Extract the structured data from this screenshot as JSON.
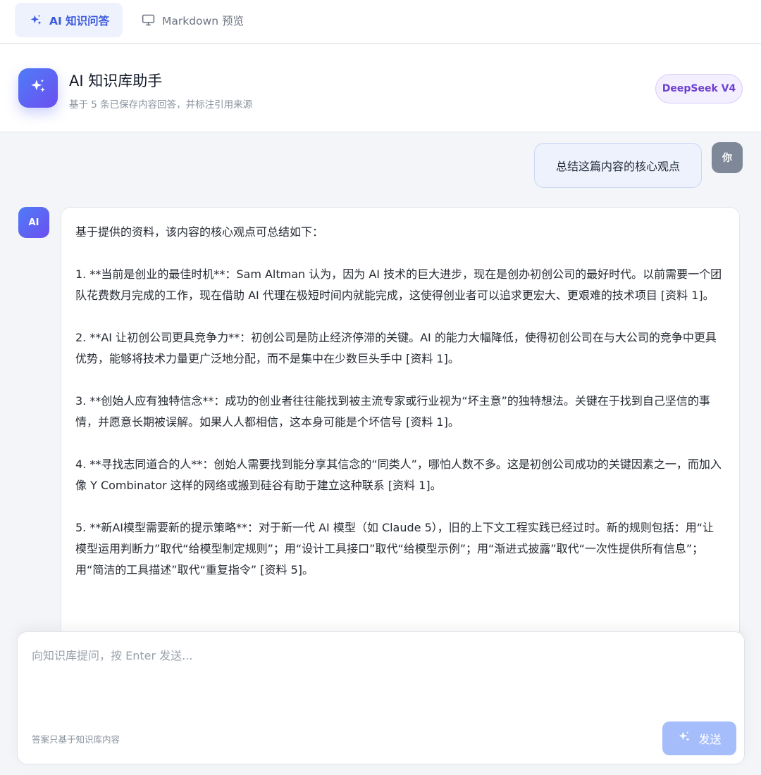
{
  "tabs": [
    {
      "label": "AI 知识问答",
      "icon": "sparkle-icon",
      "active": true
    },
    {
      "label": "Markdown 预览",
      "icon": "monitor-icon",
      "active": false
    }
  ],
  "header": {
    "title": "AI 知识库助手",
    "subtitle": "基于 5 条已保存内容回答，并标注引用来源",
    "logo_icon": "sparkle-icon",
    "model_badge": "DeepSeek V4"
  },
  "chat": {
    "user": {
      "avatar_label": "你",
      "message": "总结这篇内容的核心观点"
    },
    "assistant": {
      "avatar_label": "AI",
      "message": "基于提供的资料，该内容的核心观点可总结如下：\n\n1. **当前是创业的最佳时机**：Sam Altman 认为，因为 AI 技术的巨大进步，现在是创办初创公司的最好时代。以前需要一个团队花费数月完成的工作，现在借助 AI 代理在极短时间内就能完成，这使得创业者可以追求更宏大、更艰难的技术项目 [资料 1]。\n\n2. **AI 让初创公司更具竞争力**：初创公司是防止经济停滞的关键。AI 的能力大幅降低，使得初创公司在与大公司的竞争中更具优势，能够将技术力量更广泛地分配，而不是集中在少数巨头手中 [资料 1]。\n\n3. **创始人应有独特信念**：成功的创业者往往能找到被主流专家或行业视为“坏主意”的独特想法。关键在于找到自己坚信的事情，并愿意长期被误解。如果人人都相信，这本身可能是个坏信号 [资料 1]。\n\n4. **寻找志同道合的人**：创始人需要找到能分享其信念的“同类人”，哪怕人数不多。这是初创公司成功的关键因素之一，而加入像 Y Combinator 这样的网络或搬到硅谷有助于建立这种联系 [资料 1]。\n\n5. **新AI模型需要新的提示策略**：对于新一代 AI 模型（如 Claude 5），旧的上下文工程实践已经过时。新的规则包括：用“让模型运用判断力”取代“给模型制定规则”；用“设计工具接口”取代“给模型示例”；用“渐进式披露”取代“一次性提供所有信息”；用“简洁的工具描述”取代“重复指令” [资料 5]。"
    }
  },
  "composer": {
    "placeholder": "向知识库提问，按 Enter 发送...",
    "value": "",
    "hint": "答案只基于知识库内容",
    "send_label": "发送",
    "send_icon": "sparkle-icon"
  },
  "colors": {
    "accent": "#3b5bdb",
    "accent_gradient_start": "#4f7cf7",
    "accent_gradient_end": "#6b4ff0",
    "badge_text": "#6d3fd0",
    "send_disabled": "#a5bdfb",
    "user_avatar": "#7e8898"
  }
}
